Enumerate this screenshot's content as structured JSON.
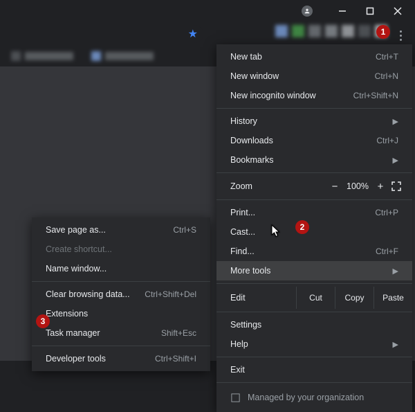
{
  "window_controls": {
    "minimize": "–",
    "maximize": "▢",
    "close": "×"
  },
  "toolbar": {
    "extension_count": 7,
    "bookmarks_count": 2
  },
  "menu": {
    "new_tab": {
      "label": "New tab",
      "shortcut": "Ctrl+T"
    },
    "new_window": {
      "label": "New window",
      "shortcut": "Ctrl+N"
    },
    "new_incognito": {
      "label": "New incognito window",
      "shortcut": "Ctrl+Shift+N"
    },
    "history": {
      "label": "History"
    },
    "downloads": {
      "label": "Downloads",
      "shortcut": "Ctrl+J"
    },
    "bookmarks": {
      "label": "Bookmarks"
    },
    "zoom": {
      "label": "Zoom",
      "minus": "−",
      "pct": "100%",
      "plus": "+"
    },
    "print": {
      "label": "Print...",
      "shortcut": "Ctrl+P"
    },
    "cast": {
      "label": "Cast..."
    },
    "find": {
      "label": "Find...",
      "shortcut": "Ctrl+F"
    },
    "more_tools": {
      "label": "More tools"
    },
    "edit": {
      "label": "Edit",
      "cut": "Cut",
      "copy": "Copy",
      "paste": "Paste"
    },
    "settings": {
      "label": "Settings"
    },
    "help": {
      "label": "Help"
    },
    "exit": {
      "label": "Exit"
    },
    "managed": {
      "label": "Managed by your organization"
    }
  },
  "submenu": {
    "save_page": {
      "label": "Save page as...",
      "shortcut": "Ctrl+S"
    },
    "create_shortcut": {
      "label": "Create shortcut..."
    },
    "name_window": {
      "label": "Name window..."
    },
    "clear_data": {
      "label": "Clear browsing data...",
      "shortcut": "Ctrl+Shift+Del"
    },
    "extensions": {
      "label": "Extensions"
    },
    "task_manager": {
      "label": "Task manager",
      "shortcut": "Shift+Esc"
    },
    "dev_tools": {
      "label": "Developer tools",
      "shortcut": "Ctrl+Shift+I"
    }
  },
  "badges": {
    "one": "1",
    "two": "2",
    "three": "3"
  }
}
